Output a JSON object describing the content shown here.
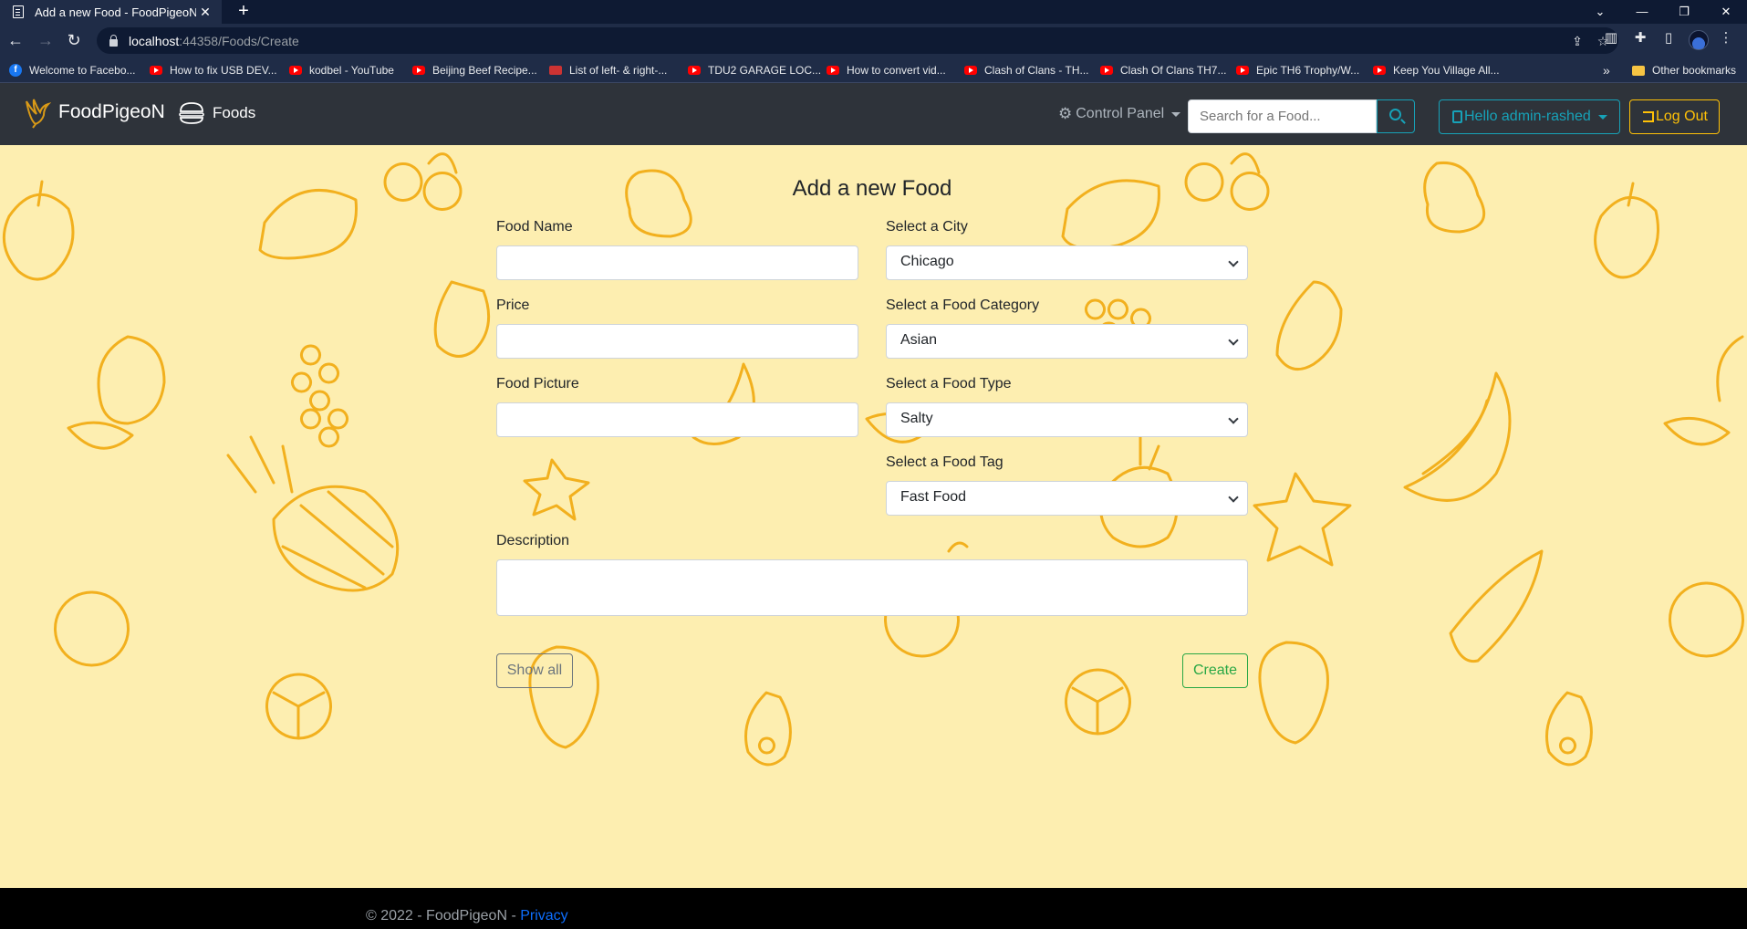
{
  "browser": {
    "tab_title": "Add a new Food - FoodPigeoN",
    "url_host": "localhost",
    "url_path": ":44358/Foods/Create",
    "bookmarks": [
      {
        "label": "Welcome to Facebo...",
        "icon": "facebook-icon"
      },
      {
        "label": "How to fix USB DEV...",
        "icon": "youtube-icon"
      },
      {
        "label": "kodbel - YouTube",
        "icon": "youtube-icon"
      },
      {
        "label": "Beijing Beef Recipe...",
        "icon": "youtube-icon"
      },
      {
        "label": "List of left- & right-...",
        "icon": "site-icon"
      },
      {
        "label": "TDU2 GARAGE LOC...",
        "icon": "youtube-icon"
      },
      {
        "label": "How to convert vid...",
        "icon": "youtube-icon"
      },
      {
        "label": "Clash of Clans - TH...",
        "icon": "youtube-icon"
      },
      {
        "label": "Clash Of Clans TH7...",
        "icon": "youtube-icon"
      },
      {
        "label": "Epic TH6 Trophy/W...",
        "icon": "youtube-icon"
      },
      {
        "label": "Keep You Village All...",
        "icon": "youtube-icon"
      }
    ],
    "more_bookmarks": "»",
    "other_bookmarks": "Other bookmarks"
  },
  "nav": {
    "brand": "FoodPigeoN",
    "foods": "Foods",
    "control_panel": "Control Panel",
    "search_placeholder": "Search for a Food...",
    "user": "Hello admin-rashed",
    "logout": "Log Out"
  },
  "form": {
    "title": "Add a new Food",
    "food_name_label": "Food Name",
    "food_name_value": "",
    "price_label": "Price",
    "price_value": "",
    "picture_label": "Food Picture",
    "picture_value": "",
    "city_label": "Select a City",
    "city_value": "Chicago",
    "category_label": "Select a Food Category",
    "category_value": "Asian",
    "type_label": "Select a Food Type",
    "type_value": "Salty",
    "tag_label": "Select a Food Tag",
    "tag_value": "Fast Food",
    "description_label": "Description",
    "show_all": "Show all",
    "create": "Create"
  },
  "footer": {
    "text": "© 2022 - FoodPigeoN - ",
    "privacy": "Privacy"
  },
  "colors": {
    "page_bg": "#fdeeb0",
    "navbar_bg": "#2e333a",
    "accent_info": "#17a2b8",
    "accent_warning": "#ffc107",
    "accent_success": "#28a745",
    "decor_stroke": "#f2b01e"
  }
}
